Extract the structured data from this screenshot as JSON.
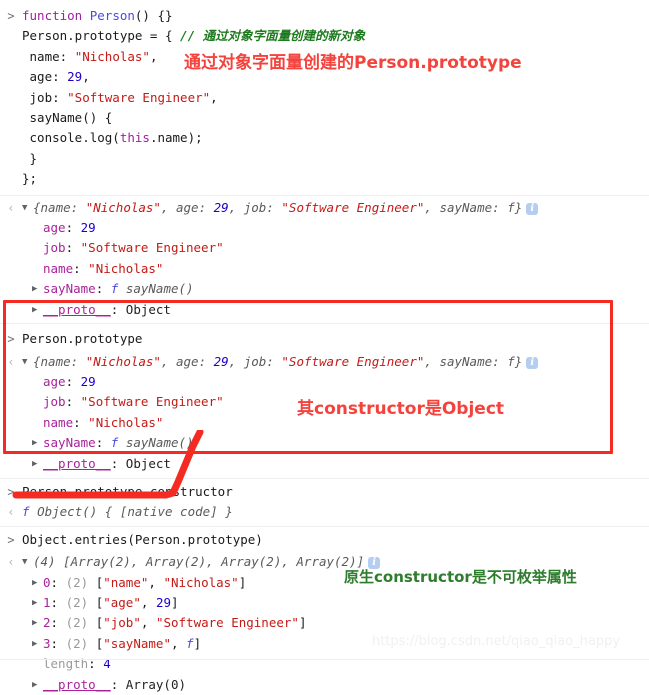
{
  "console": {
    "prompt_glyph": ">",
    "response_glyph": "‹",
    "triangle_closed": "▶",
    "triangle_open": "▼",
    "info_glyph": "i",
    "blocks": [
      {
        "id": "input-1",
        "kind": "input",
        "lines": [
          "function Person() {}",
          "Person.prototype = { // 通过对象字面量创建的新对象",
          " name: \"Nicholas\",",
          " age: 29,",
          " job: \"Software Engineer\",",
          " sayName() {",
          " console.log(this.name);",
          " }",
          "};"
        ]
      },
      {
        "id": "output-1",
        "kind": "output",
        "summary": "{name: \"Nicholas\", age: 29, job: \"Software Engineer\", sayName: f}",
        "properties": [
          {
            "key": "age",
            "value": "29",
            "expandable": false
          },
          {
            "key": "job",
            "value": "\"Software Engineer\"",
            "expandable": false
          },
          {
            "key": "name",
            "value": "\"Nicholas\"",
            "expandable": false
          },
          {
            "key": "sayName",
            "value": "f sayName()",
            "expandable": true
          },
          {
            "key": "__proto__",
            "value": "Object",
            "expandable": true
          }
        ]
      },
      {
        "id": "input-2",
        "kind": "input",
        "lines": [
          "Person.prototype"
        ]
      },
      {
        "id": "output-2",
        "kind": "output",
        "summary": "{name: \"Nicholas\", age: 29, job: \"Software Engineer\", sayName: f}",
        "properties": [
          {
            "key": "age",
            "value": "29",
            "expandable": false
          },
          {
            "key": "job",
            "value": "\"Software Engineer\"",
            "expandable": false
          },
          {
            "key": "name",
            "value": "\"Nicholas\"",
            "expandable": false
          },
          {
            "key": "sayName",
            "value": "f sayName()",
            "expandable": true
          },
          {
            "key": "__proto__",
            "value": "Object",
            "expandable": true
          }
        ]
      },
      {
        "id": "input-3",
        "kind": "input",
        "lines": [
          "Person.prototype.constructor"
        ]
      },
      {
        "id": "output-3",
        "kind": "output",
        "summary": "f Object() { [native code] }",
        "properties": []
      },
      {
        "id": "input-4",
        "kind": "input",
        "lines": [
          "Object.entries(Person.prototype)"
        ]
      },
      {
        "id": "output-4",
        "kind": "output",
        "summary": "(4) [Array(2), Array(2), Array(2), Array(2)]",
        "properties": [
          {
            "key": "0",
            "value": "(2) [\"name\", \"Nicholas\"]",
            "expandable": true
          },
          {
            "key": "1",
            "value": "(2) [\"age\", 29]",
            "expandable": true
          },
          {
            "key": "2",
            "value": "(2) [\"job\", \"Software Engineer\"]",
            "expandable": true
          },
          {
            "key": "3",
            "value": "(2) [\"sayName\", f]",
            "expandable": true
          },
          {
            "key": "length",
            "value": "4",
            "expandable": false
          },
          {
            "key": "__proto__",
            "value": "Array(0)",
            "expandable": true
          }
        ]
      }
    ]
  },
  "annotations": {
    "inline_comment": "// 通过对象字面量创建的新对象",
    "note_1": "通过对象字面量创建的Person.prototype",
    "note_2": "其constructor是Object",
    "note_3": "原生constructor是不可枚举属性",
    "colors": {
      "note_red": "#f4433c",
      "note_green": "#2d7d2d",
      "highlight_box": "#f42b22",
      "string": "#c41a16",
      "number": "#1c00cf",
      "property": "#a9229a",
      "keyword": "#a020a0",
      "comment": "#1d7a1d"
    }
  },
  "watermark": {
    "text": "https://blog.csdn.net/qiao_qiao_happy"
  }
}
